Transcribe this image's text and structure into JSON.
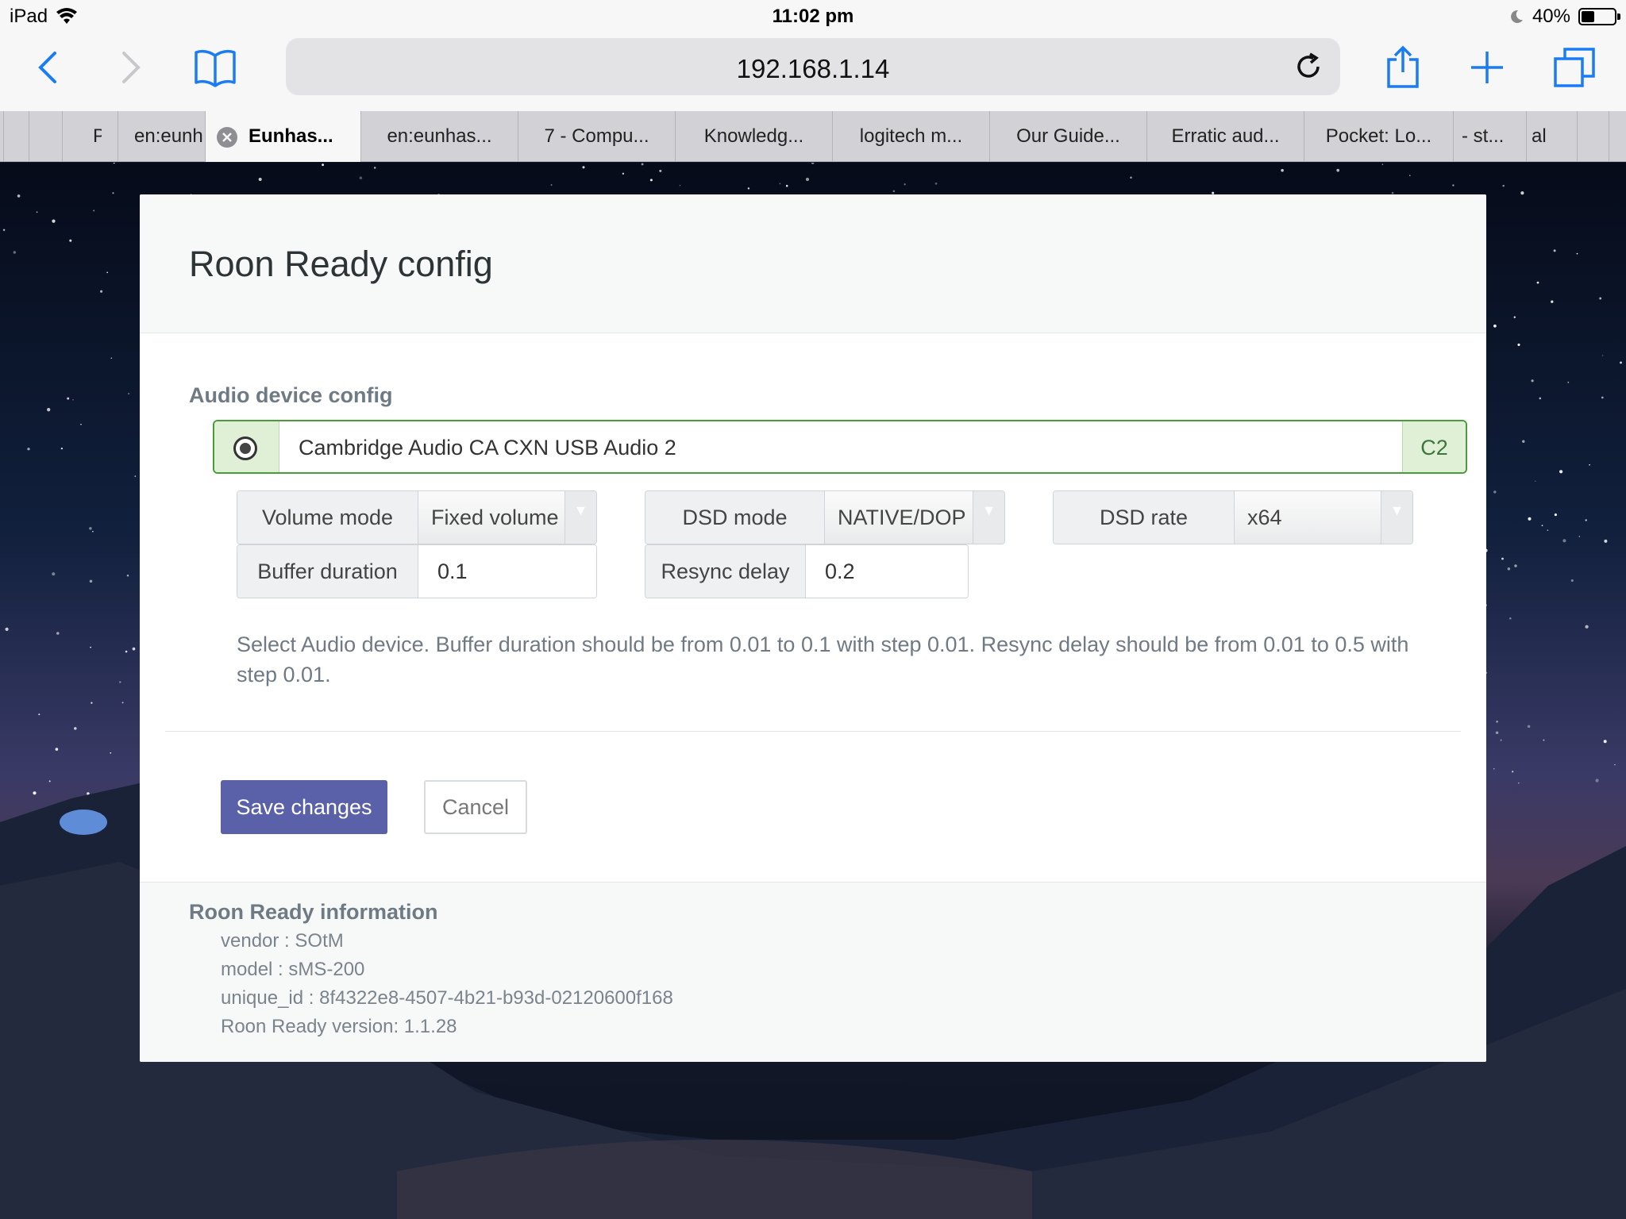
{
  "status_bar": {
    "device": "iPad",
    "time": "11:02 pm",
    "battery": "40%",
    "battery_level": 0.4
  },
  "browser": {
    "url": "192.168.1.14",
    "tabs": [
      {
        "label": "P"
      },
      {
        "label": "en:eunh"
      },
      {
        "label": "Eunhas...",
        "active": true
      },
      {
        "label": "en:eunhas..."
      },
      {
        "label": "7 - Compu..."
      },
      {
        "label": "Knowledg..."
      },
      {
        "label": "logitech m..."
      },
      {
        "label": "Our Guide..."
      },
      {
        "label": "Erratic aud..."
      },
      {
        "label": "Pocket: Lo..."
      },
      {
        "label": "- st..."
      },
      {
        "label": "al"
      }
    ]
  },
  "card": {
    "title": "Roon Ready config",
    "section_label": "Audio device config",
    "device": {
      "name": "Cambridge Audio CA CXN USB Audio 2",
      "tag": "C2"
    },
    "fields": {
      "volume_mode": {
        "label": "Volume mode",
        "value": "Fixed volume"
      },
      "dsd_mode": {
        "label": "DSD mode",
        "value": "NATIVE/DOP"
      },
      "dsd_rate": {
        "label": "DSD rate",
        "value": "x64"
      },
      "buffer_duration": {
        "label": "Buffer duration",
        "value": "0.1"
      },
      "resync_delay": {
        "label": "Resync delay",
        "value": "0.2"
      }
    },
    "help_text": "Select Audio device. Buffer duration should be from 0.01 to 0.1 with step 0.01. Resync delay should be from 0.01 to 0.5 with step 0.01.",
    "save_label": "Save changes",
    "cancel_label": "Cancel",
    "info": {
      "title": "Roon Ready information",
      "vendor": "vendor : SOtM",
      "model": "model : sMS-200",
      "unique_id": "unique_id : 8f4322e8-4507-4b21-b93d-02120600f168",
      "version": "Roon Ready version: 1.1.28"
    }
  },
  "colors": {
    "accent": "#5b61a8",
    "success_border": "#4a9c3b",
    "success_bg": "#dff0d6",
    "browser_blue": "#1a7cf5"
  },
  "icons": [
    "wifi-icon",
    "moon-icon",
    "battery-icon",
    "back-icon",
    "forward-icon",
    "bookmarks-icon",
    "reload-icon",
    "share-icon",
    "new-tab-icon",
    "tabs-icon",
    "close-tab-icon",
    "radio-icon",
    "caret-down-icon"
  ]
}
